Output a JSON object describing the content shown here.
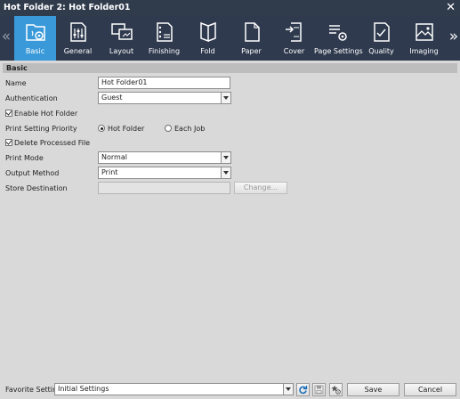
{
  "window": {
    "title": "Hot Folder 2: Hot Folder01"
  },
  "tabs": [
    {
      "label": "Basic",
      "icon": "folder-gear-icon"
    },
    {
      "label": "General",
      "icon": "sliders-doc-icon"
    },
    {
      "label": "Layout",
      "icon": "layout-icon"
    },
    {
      "label": "Finishing",
      "icon": "finishing-icon"
    },
    {
      "label": "Fold",
      "icon": "fold-icon"
    },
    {
      "label": "Paper",
      "icon": "paper-icon"
    },
    {
      "label": "Cover",
      "icon": "cover-icon"
    },
    {
      "label": "Page Settings",
      "icon": "page-settings-icon"
    },
    {
      "label": "Quality",
      "icon": "quality-icon"
    },
    {
      "label": "Imaging",
      "icon": "imaging-icon"
    }
  ],
  "active_tab": "Basic",
  "section": {
    "title": "Basic"
  },
  "form": {
    "name_label": "Name",
    "name_value": "Hot Folder01",
    "auth_label": "Authentication",
    "auth_value": "Guest",
    "enable_hot_folder": "Enable Hot Folder",
    "print_priority_label": "Print Setting Priority",
    "priority_option_1": "Hot Folder",
    "priority_option_2": "Each Job",
    "priority_selected": "Hot Folder",
    "delete_processed": "Delete Processed File",
    "print_mode_label": "Print Mode",
    "print_mode_value": "Normal",
    "output_method_label": "Output Method",
    "output_method_value": "Print",
    "store_dest_label": "Store Destination",
    "store_dest_value": "",
    "change_button": "Change..."
  },
  "footer": {
    "favorite_label": "Favorite Setting",
    "favorite_value": "Initial Settings",
    "save_button": "Save",
    "cancel_button": "Cancel"
  },
  "colors": {
    "titlebar": "#303b4c",
    "tabstrip": "#2f3a4e",
    "active_tab": "#3a9ad9",
    "background": "#d9d9d9"
  }
}
